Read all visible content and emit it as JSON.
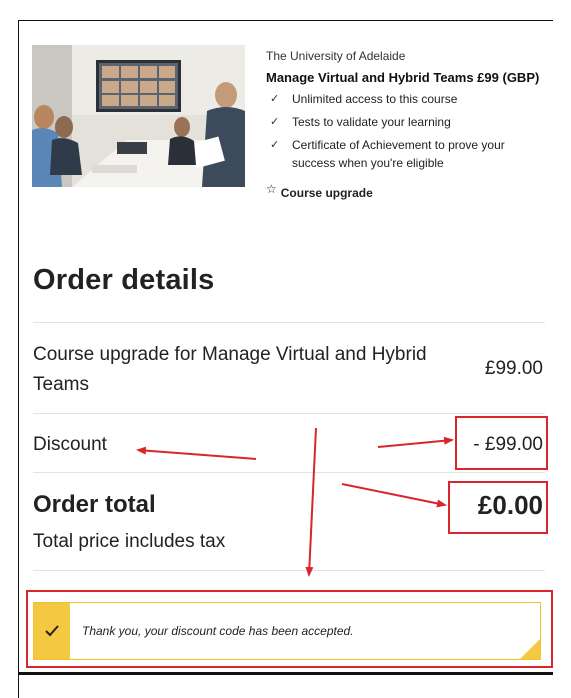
{
  "course": {
    "university": "The University of Adelaide",
    "title": "Manage Virtual and Hybrid Teams £99 (GBP)",
    "features": [
      "Unlimited access to this course",
      "Tests to validate your learning",
      "Certificate of Achievement to prove your success when you're eligible"
    ],
    "check_glyph": "✓",
    "upgrade_star": "☆",
    "upgrade_label": "Course upgrade"
  },
  "order": {
    "heading": "Order details",
    "item_label": "Course upgrade for Manage Virtual and Hybrid Teams",
    "item_price": "£99.00",
    "discount_label": "Discount",
    "discount_value": "- £99.00",
    "total_label": "Order total",
    "total_value": "£0.00",
    "tax_note": "Total price includes tax"
  },
  "notice": {
    "text": "Thank you, your discount code has been accepted."
  },
  "colors": {
    "annotation_red": "#d9262c",
    "notice_yellow": "#f5c842",
    "text_dark": "#222222"
  }
}
